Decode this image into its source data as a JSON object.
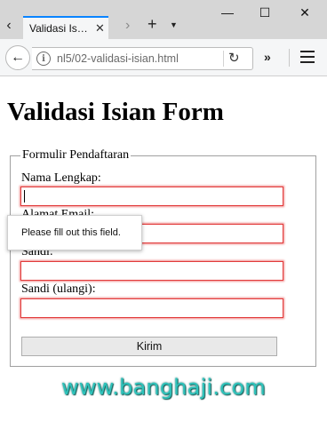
{
  "browser": {
    "tab_title": "Validasi Is…",
    "url": "nl5/02-validasi-isian.html",
    "controls": {
      "tab_scroll_left": "‹",
      "tab_close": "✕",
      "tab_scroll_right": "›",
      "new_tab": "+",
      "tab_list": "▼",
      "minimize": "—",
      "maximize": "☐",
      "close_window": "✕",
      "back": "←",
      "info": "i",
      "reload": "↻",
      "overflow": "»"
    },
    "icons": [
      "back-arrow-icon",
      "info-icon",
      "reload-icon",
      "hamburger-menu-icon"
    ]
  },
  "page": {
    "heading": "Validasi Isian Form",
    "legend": "Formulir Pendaftaran",
    "fields": [
      {
        "label": "Nama Lengkap:",
        "value": ""
      },
      {
        "label": "Alamat Email:",
        "value": ""
      },
      {
        "label": "Sandi:",
        "value": ""
      },
      {
        "label": "Sandi (ulangi):",
        "value": ""
      }
    ],
    "submit_label": "Kirim",
    "tooltip": "Please fill out this field.",
    "invalid_border_color": "#e23b3b"
  },
  "watermark": "www.banghaji.com"
}
